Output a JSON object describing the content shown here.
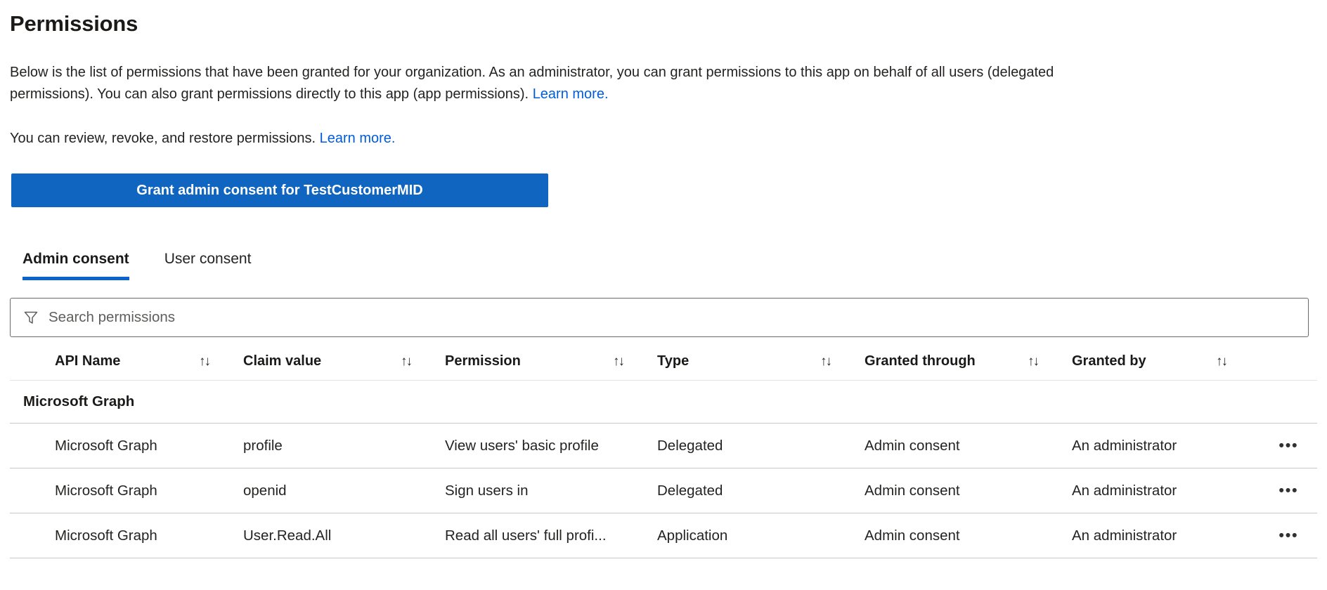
{
  "page": {
    "title": "Permissions",
    "intro_text": "Below is the list of permissions that have been granted for your organization. As an administrator, you can grant permissions to this app on behalf of all users (delegated permissions). You can also grant permissions directly to this app (app permissions).",
    "intro_link": "Learn more.",
    "review_text": "You can review, revoke, and restore permissions.",
    "review_link": "Learn more."
  },
  "grant_button": {
    "label": "Grant admin consent for TestCustomerMID"
  },
  "tabs": [
    {
      "label": "Admin consent",
      "active": true
    },
    {
      "label": "User consent",
      "active": false
    }
  ],
  "search": {
    "placeholder": "Search permissions",
    "icon": "filter-funnel-icon"
  },
  "table": {
    "columns": [
      "API Name",
      "Claim value",
      "Permission",
      "Type",
      "Granted through",
      "Granted by"
    ],
    "sort_icon": "↑↓",
    "menu_icon": "•••",
    "group_header": "Microsoft Graph",
    "rows": [
      {
        "api_name": "Microsoft Graph",
        "claim_value": "profile",
        "permission": "View users' basic profile",
        "type": "Delegated",
        "granted_through": "Admin consent",
        "granted_by": "An administrator"
      },
      {
        "api_name": "Microsoft Graph",
        "claim_value": "openid",
        "permission": "Sign users in",
        "type": "Delegated",
        "granted_through": "Admin consent",
        "granted_by": "An administrator"
      },
      {
        "api_name": "Microsoft Graph",
        "claim_value": "User.Read.All",
        "permission": "Read all users' full profi...",
        "type": "Application",
        "granted_through": "Admin consent",
        "granted_by": "An administrator"
      }
    ]
  },
  "colors": {
    "accent_button": "#1065c0",
    "tab_underline": "#0b63ce",
    "link": "#015cda"
  }
}
